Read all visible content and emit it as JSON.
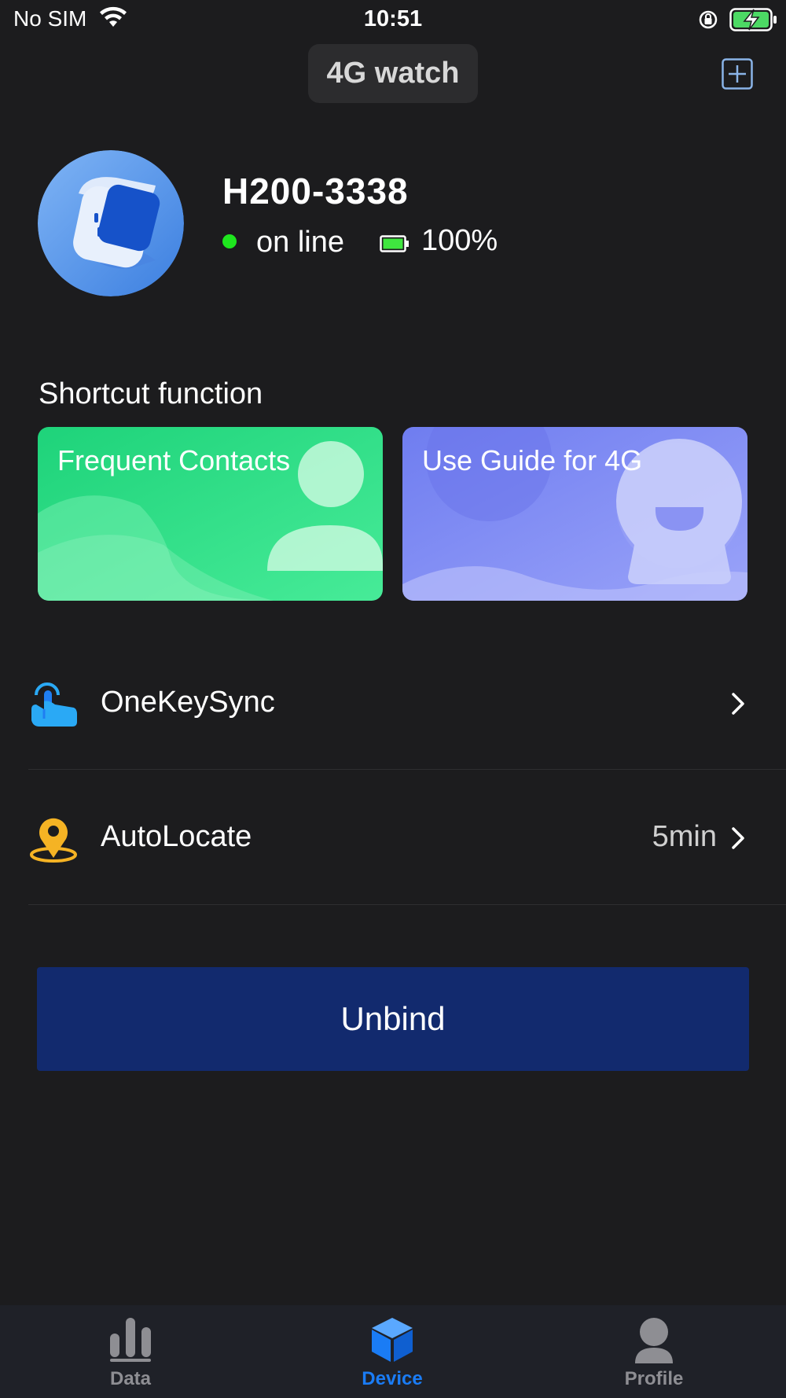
{
  "status_bar": {
    "carrier": "No SIM",
    "time": "10:51",
    "icons": [
      "wifi-icon",
      "orientation-lock-icon",
      "battery-charging-icon"
    ]
  },
  "header": {
    "title": "4G watch",
    "add_icon": "plus-square-icon"
  },
  "device": {
    "name": "H200-3338",
    "status": "on line",
    "status_color": "#1ee61e",
    "battery": "100%",
    "battery_level": 1.0,
    "avatar_icon": "smartwatch-icon"
  },
  "shortcuts": {
    "title": "Shortcut function",
    "items": [
      {
        "label": "Frequent Contacts",
        "icon": "person-icon",
        "color": "#2fd97e"
      },
      {
        "label": "Use Guide for 4G",
        "icon": "robot-icon",
        "color": "#8a93f7"
      }
    ]
  },
  "settings": [
    {
      "label": "OneKeySync",
      "value": "",
      "icon": "tap-sync-icon"
    },
    {
      "label": "AutoLocate",
      "value": "5min",
      "icon": "location-pin-icon"
    }
  ],
  "unbind_label": "Unbind",
  "unbind_color": "#122a6e",
  "tabs": [
    {
      "label": "Data",
      "icon": "bar-chart-icon",
      "active": false
    },
    {
      "label": "Device",
      "icon": "cube-icon",
      "active": true
    },
    {
      "label": "Profile",
      "icon": "user-icon",
      "active": false
    }
  ],
  "accent": "#1a7cf5"
}
